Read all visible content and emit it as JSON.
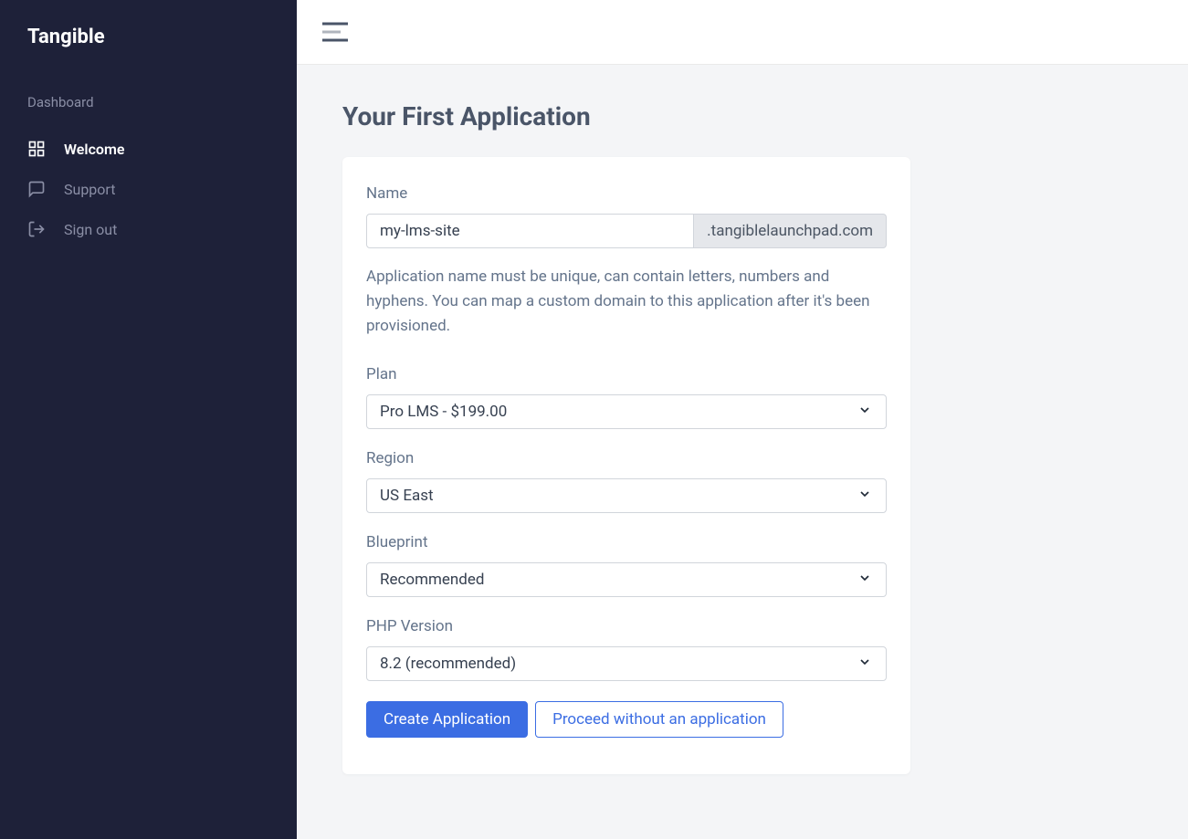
{
  "brand": "Tangible",
  "sidebar": {
    "section_label": "Dashboard",
    "items": [
      {
        "label": "Welcome"
      },
      {
        "label": "Support"
      },
      {
        "label": "Sign out"
      }
    ]
  },
  "page": {
    "title": "Your First Application"
  },
  "form": {
    "name": {
      "label": "Name",
      "value": "my-lms-site",
      "suffix": ".tangiblelaunchpad.com",
      "help": "Application name must be unique, can contain letters, numbers and hyphens. You can map a custom domain to this application after it's been provisioned."
    },
    "plan": {
      "label": "Plan",
      "value": "Pro LMS - $199.00"
    },
    "region": {
      "label": "Region",
      "value": "US East"
    },
    "blueprint": {
      "label": "Blueprint",
      "value": "Recommended"
    },
    "php_version": {
      "label": "PHP Version",
      "value": "8.2 (recommended)"
    },
    "buttons": {
      "create": "Create Application",
      "skip": "Proceed without an application"
    }
  }
}
